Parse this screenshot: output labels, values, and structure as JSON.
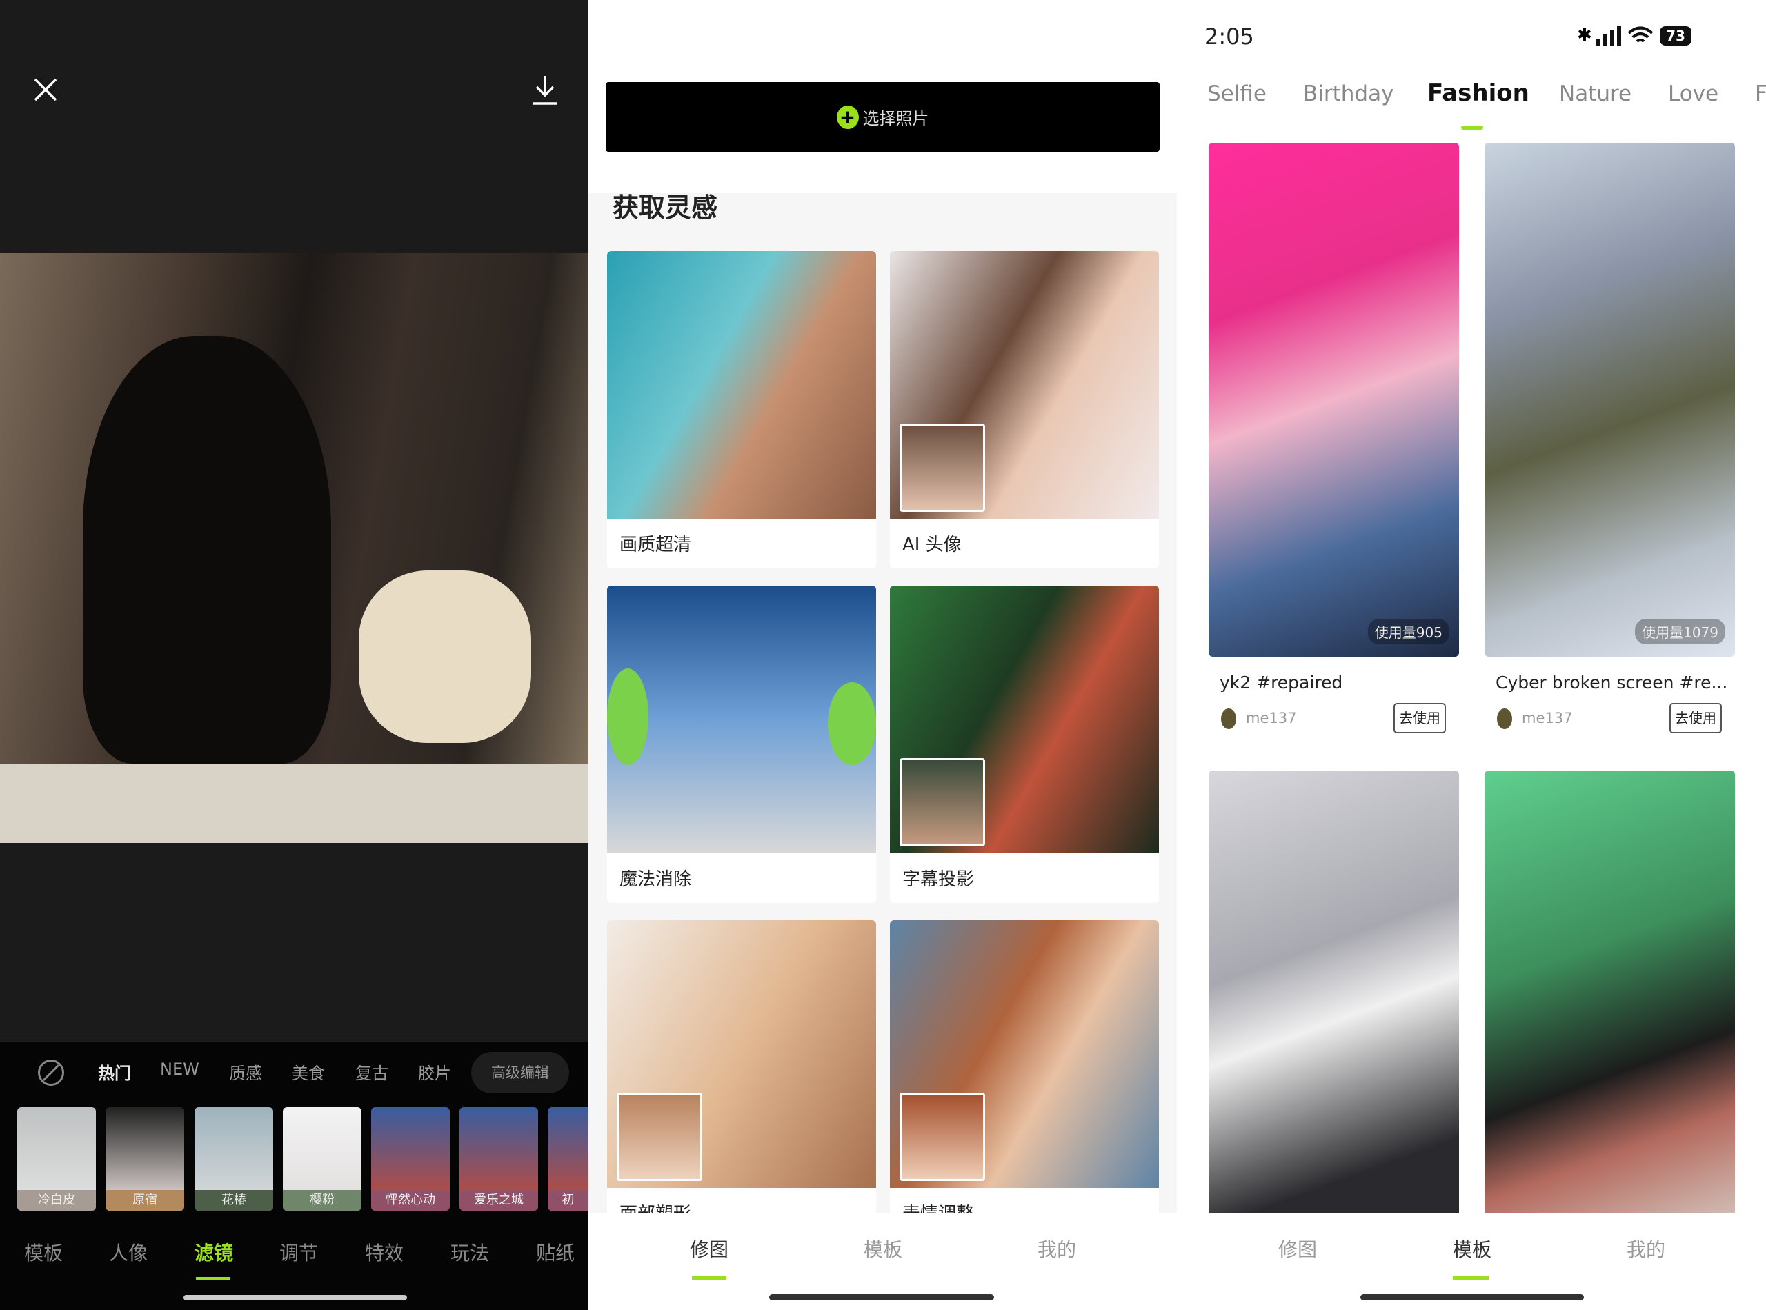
{
  "left_panel": {
    "close_icon": "close-icon",
    "download_icon": "download-icon",
    "filter_categories": [
      "热门",
      "NEW",
      "质感",
      "美食",
      "复古",
      "胶片"
    ],
    "advanced_edit": "高级编辑",
    "filters": [
      {
        "label": "冷白皮",
        "color": "#a79c94"
      },
      {
        "label": "原宿",
        "color": "#b38a5e"
      },
      {
        "label": "花椿",
        "color": "#4d5e49"
      },
      {
        "label": "樱粉",
        "color": "#6f866a"
      },
      {
        "label": "怦然心动",
        "color": "#8f5068"
      },
      {
        "label": "爱乐之城",
        "color": "#8f5068"
      },
      {
        "label": "初",
        "color": "#8f5068"
      }
    ],
    "tools": [
      "模板",
      "人像",
      "滤镜",
      "调节",
      "特效",
      "玩法",
      "贴纸"
    ],
    "active_tool": "滤镜",
    "accent": "#9be01e"
  },
  "middle_panel": {
    "select_photo": "选择照片",
    "section_title": "获取灵感",
    "features": [
      "画质超清",
      "AI 头像",
      "魔法消除",
      "字幕投影",
      "面部塑形",
      "表情调整"
    ],
    "nav": [
      "修图",
      "模板",
      "我的"
    ],
    "active_nav": "修图"
  },
  "right_panel": {
    "status": {
      "time": "2:05",
      "battery": "73"
    },
    "tabs": [
      "Selfie",
      "Birthday",
      "Fashion",
      "Nature",
      "Love",
      "F"
    ],
    "active_tab": "Fashion",
    "templates": [
      {
        "title": "yk2 #repaired",
        "author": "me137",
        "uses": "使用量905",
        "action": "去使用"
      },
      {
        "title": "Cyber broken screen #re...",
        "author": "me137",
        "uses": "使用量1079",
        "action": "去使用"
      }
    ],
    "nav": [
      "修图",
      "模板",
      "我的"
    ],
    "active_nav": "模板"
  }
}
